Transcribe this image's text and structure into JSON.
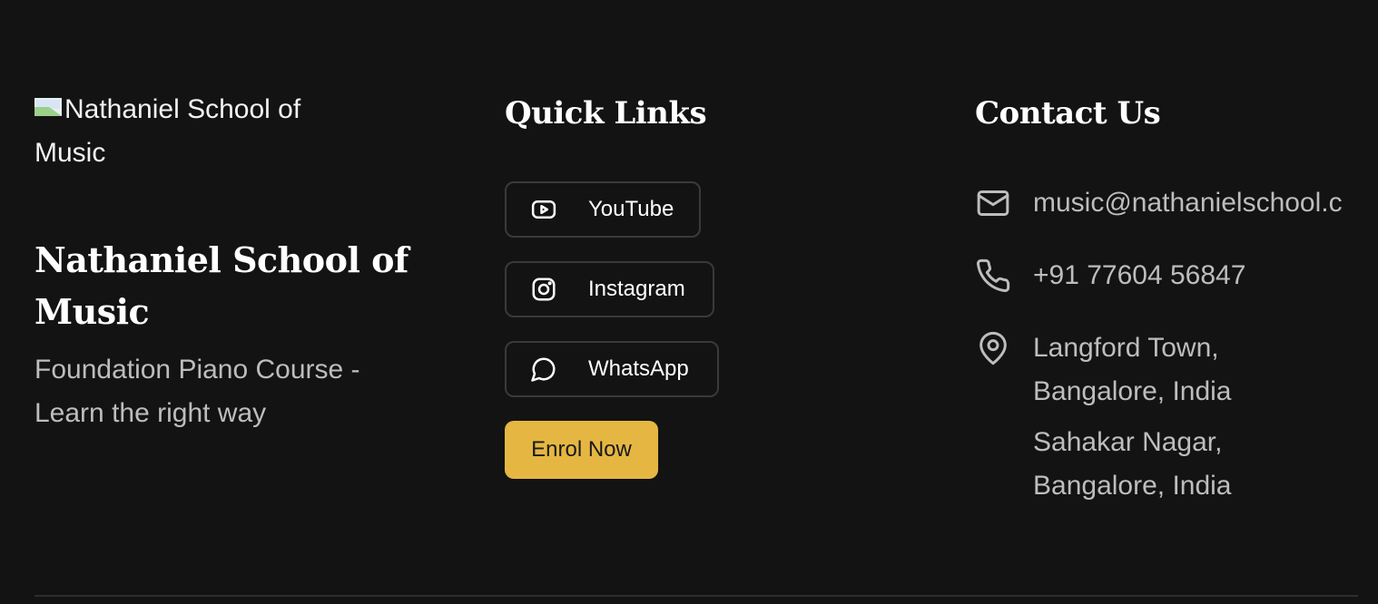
{
  "brand": {
    "logo_alt": "Nathaniel School of Music",
    "title": "Nathaniel School of Music",
    "subtitle": "Foundation Piano Course - Learn the right way"
  },
  "quick_links": {
    "heading": "Quick Links",
    "items": [
      {
        "label": "YouTube",
        "icon": "youtube-icon"
      },
      {
        "label": "Instagram",
        "icon": "instagram-icon"
      },
      {
        "label": "WhatsApp",
        "icon": "whatsapp-icon"
      }
    ],
    "cta": "Enrol Now"
  },
  "contact": {
    "heading": "Contact Us",
    "email": "music@nathanielschool.c",
    "phone": "+91 77604 56847",
    "locations": [
      {
        "line1": "Langford Town,",
        "line2": "Bangalore, India"
      },
      {
        "line1": "Sahakar Nagar,",
        "line2": "Bangalore, India"
      }
    ]
  },
  "colors": {
    "background": "#131313",
    "accent": "#e5b742",
    "text_primary": "#ffffff",
    "text_muted": "#bdbdbd",
    "border": "#3a3a3a"
  }
}
